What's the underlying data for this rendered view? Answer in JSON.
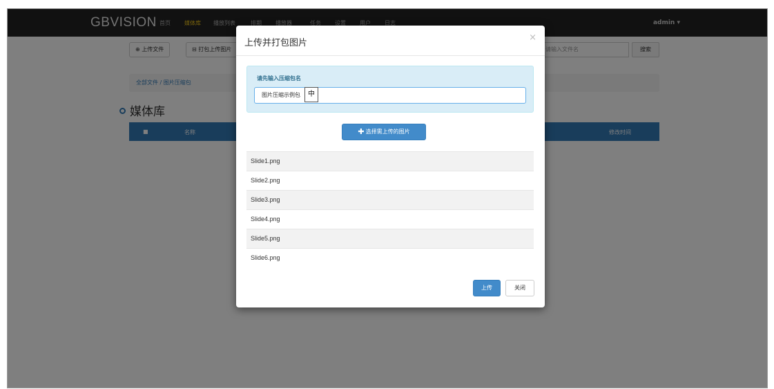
{
  "navbar": {
    "brand": "GBVISION",
    "items": [
      "首页",
      "媒体库",
      "播放列表",
      "排期",
      "播放器",
      "任务",
      "设置",
      "用户",
      "日志"
    ],
    "active_index": 1,
    "user": "admin ▾"
  },
  "toolbar": {
    "upload_label": "⊕ 上传文件",
    "pack_upload_label": "⊟ 打包上传图片",
    "search_placeholder": "请输入文件名",
    "search_label": "搜索"
  },
  "breadcrumb": "全部文件 / 图片压缩包",
  "page_title": "媒体库",
  "table_headers": [
    "■",
    "名称",
    "修改时间"
  ],
  "modal": {
    "title": "上传并打包图片",
    "close": "×",
    "label": "请先输入压缩包名",
    "input_value": "图片压缩示例包",
    "ime_indicator": "中",
    "select_button": "选择需上传的图片",
    "files": [
      "Slide1.png",
      "Slide2.png",
      "Slide3.png",
      "Slide4.png",
      "Slide5.png",
      "Slide6.png"
    ],
    "upload_button": "上传",
    "close_button": "关闭"
  },
  "colors": {
    "primary": "#428bca",
    "navbar": "#222222",
    "active_nav": "#f0c419",
    "panel": "#d9edf7"
  }
}
